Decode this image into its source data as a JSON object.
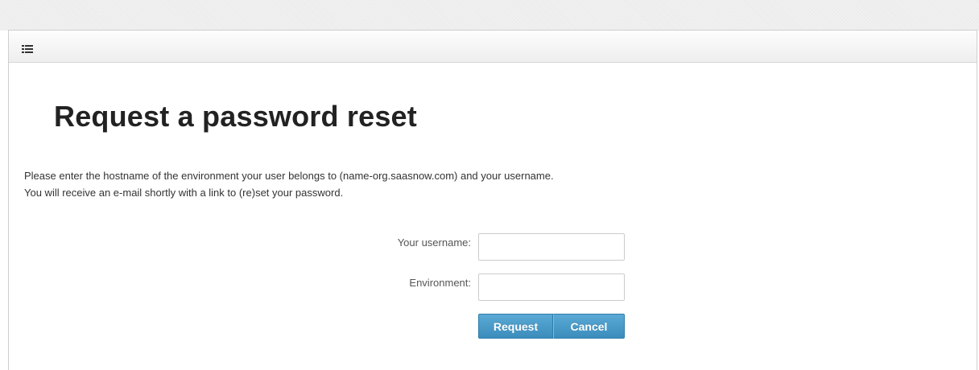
{
  "header": {
    "icon": "list-icon"
  },
  "page": {
    "title": "Request a password reset",
    "intro_line1": "Please enter the hostname of the environment your user belongs to (name-org.saasnow.com) and your username.",
    "intro_line2": "You will receive an e-mail shortly with a link to (re)set your password."
  },
  "form": {
    "username_label": "Your username:",
    "username_value": "",
    "environment_label": "Environment:",
    "environment_value": ""
  },
  "actions": {
    "request_label": "Request",
    "cancel_label": "Cancel"
  },
  "colors": {
    "button_primary": "#3c8dbc",
    "title_text": "#222222"
  }
}
